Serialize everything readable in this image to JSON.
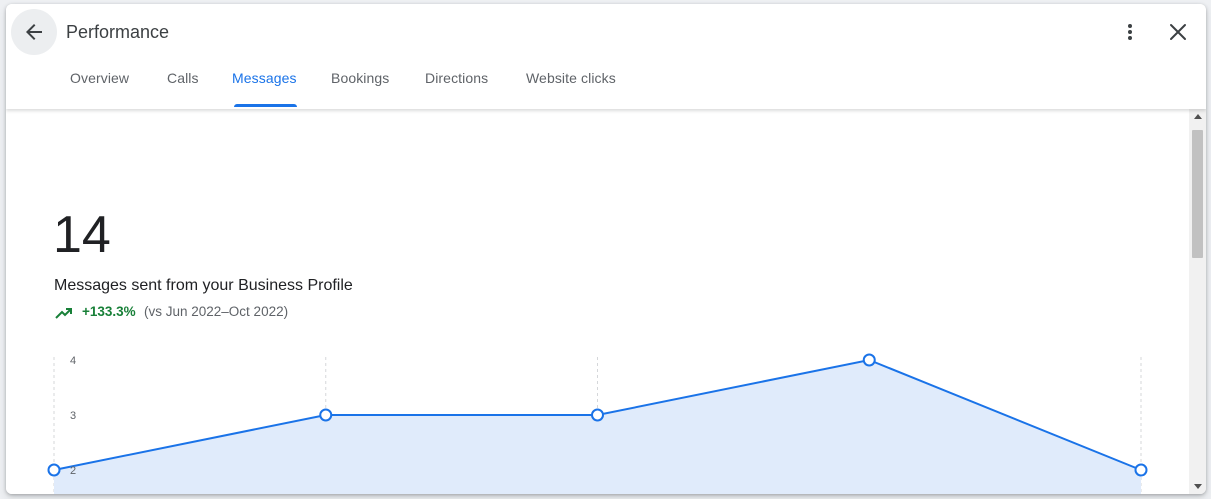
{
  "header": {
    "title": "Performance",
    "back_icon": "arrow-back-icon",
    "more_icon": "more-vert-icon",
    "close_icon": "close-icon"
  },
  "tabs": [
    {
      "label": "Overview",
      "active": false
    },
    {
      "label": "Calls",
      "active": false
    },
    {
      "label": "Messages",
      "active": true
    },
    {
      "label": "Bookings",
      "active": false
    },
    {
      "label": "Directions",
      "active": false
    },
    {
      "label": "Website clicks",
      "active": false
    }
  ],
  "metric": {
    "value": "14",
    "label": "Messages sent from your Business Profile",
    "change": "+133.3%",
    "comparison": "(vs Jun 2022–Oct 2022)",
    "trend_icon": "trending-up-icon"
  },
  "colors": {
    "accent": "#1a73e8",
    "positive": "#188038",
    "area_fill": "#e0ebfb"
  },
  "chart_data": {
    "type": "area",
    "x_points": 5,
    "values": [
      2,
      3,
      3,
      4,
      2
    ],
    "y_ticks": [
      4,
      3,
      2
    ],
    "y_visible_range": [
      2,
      4
    ],
    "grid": "vertical dashed lines at each point",
    "markers": "hollow circles"
  }
}
